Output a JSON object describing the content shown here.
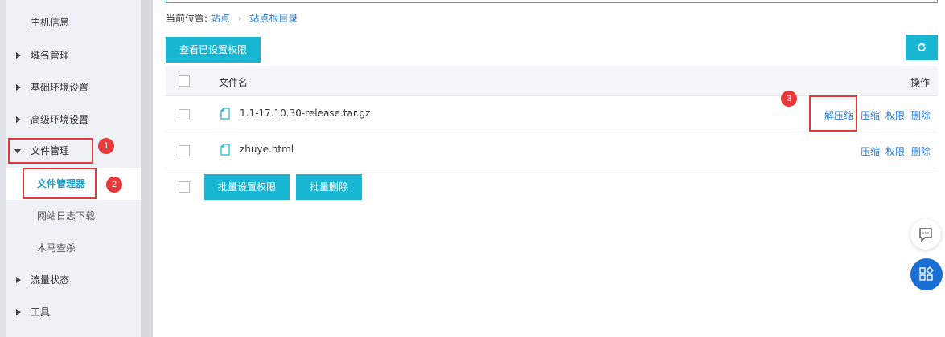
{
  "sidebar": {
    "items": [
      {
        "label": "主机信息"
      },
      {
        "label": "域名管理"
      },
      {
        "label": "基础环境设置"
      },
      {
        "label": "高级环境设置"
      },
      {
        "label": "文件管理"
      },
      {
        "label": "文件管理器"
      },
      {
        "label": "网站日志下载"
      },
      {
        "label": "木马查杀"
      },
      {
        "label": "流量状态"
      },
      {
        "label": "工具"
      }
    ]
  },
  "annotations": {
    "badge1": "1",
    "badge2": "2",
    "badge3": "3",
    "highlight_color": "#e03a3a"
  },
  "breadcrumb": {
    "prefix": "当前位置:",
    "site": "站点",
    "separator": "›",
    "root": "站点根目录"
  },
  "toolbar": {
    "view_permissions_label": "查看已设置权限",
    "refresh_icon": "refresh-icon"
  },
  "table": {
    "columns": {
      "name": "文件名",
      "actions": "操作"
    },
    "rows": [
      {
        "name": "1.1-17.10.30-release.tar.gz",
        "actions": [
          "解压缩",
          "压缩",
          "权限",
          "删除"
        ]
      },
      {
        "name": "zhuye.html",
        "actions": [
          "压缩",
          "权限",
          "删除"
        ]
      }
    ]
  },
  "bulk": {
    "set_permissions_label": "批量设置权限",
    "delete_label": "批量删除"
  },
  "colors": {
    "accent": "#19b6d4",
    "link": "#2a7bd0",
    "float_blue": "#1a6fd4"
  }
}
